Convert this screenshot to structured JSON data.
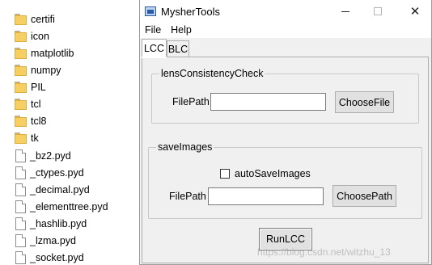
{
  "explorer": {
    "folders": [
      "certifi",
      "icon",
      "matplotlib",
      "numpy",
      "PIL",
      "tcl",
      "tcl8",
      "tk"
    ],
    "files": [
      "_bz2.pyd",
      "_ctypes.pyd",
      "_decimal.pyd",
      "_elementtree.pyd",
      "_hashlib.pyd",
      "_lzma.pyd",
      "_socket.pyd"
    ]
  },
  "window": {
    "title": "MysherTools",
    "min_symbol": "—",
    "close_symbol": "✕"
  },
  "menu": {
    "file": "File",
    "help": "Help"
  },
  "tabs": {
    "lcc": "LCC",
    "blc": "BLC"
  },
  "lcc_group": {
    "title": "lensConsistencyCheck",
    "filepath_label": "FilePath",
    "filepath_value": "",
    "choose_button": "ChooseFile"
  },
  "save_group": {
    "title": "saveImages",
    "checkbox_label": "autoSaveImages",
    "checkbox_checked": false,
    "filepath_label": "FilePath",
    "filepath_value": "",
    "choose_button": "ChoosePath"
  },
  "run_button": "RunLCC",
  "watermark": "https://blog.csdn.net/witzhu_13"
}
